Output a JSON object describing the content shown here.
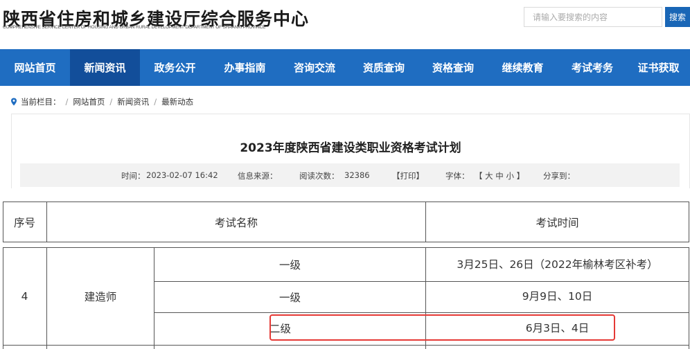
{
  "header": {
    "site_title": "陕西省住房和城乡建设厅综合服务中心",
    "site_subtitle": "COMPREHENSIVE SERVICE CENTER OF HOUSING AND URBAN RURAL DEVELOPMENT DEPARTMENT OF SHAANXI PROVINCE",
    "search_placeholder": "请输入要搜索的内容",
    "search_button": "搜索"
  },
  "nav": {
    "items": [
      {
        "label": "网站首页"
      },
      {
        "label": "新闻资讯",
        "active": true
      },
      {
        "label": "政务公开"
      },
      {
        "label": "办事指南"
      },
      {
        "label": "咨询交流"
      },
      {
        "label": "资质查询"
      },
      {
        "label": "资格查询"
      },
      {
        "label": "继续教育"
      },
      {
        "label": "考试考务"
      },
      {
        "label": "证书获取"
      }
    ]
  },
  "breadcrumb": {
    "prefix": "当前栏目：",
    "items": [
      "网站首页",
      "新闻资讯",
      "最新动态"
    ]
  },
  "article": {
    "title": "2023年度陕西省建设类职业资格考试计划",
    "meta": {
      "time_label": "时间：",
      "time_value": "2023-02-07 16:42",
      "source_label": "信息来源：",
      "views_label": "阅读次数：",
      "views_value": "32386",
      "print_label": "【打印】",
      "font_label": "字体：",
      "font_sizes": "【 大  中  小 】",
      "share_label": "分享到："
    }
  },
  "table": {
    "headers": {
      "no": "序号",
      "name": "考试名称",
      "time": "考试时间"
    },
    "row": {
      "no": "4",
      "name": "建造师",
      "sub_rows": [
        {
          "level": "一级",
          "time": "3月25日、26日（2022年榆林考区补考）"
        },
        {
          "level": "一级",
          "time": "9月9日、10日"
        },
        {
          "level": "二级",
          "time": "6月3日、4日",
          "highlighted": true
        }
      ]
    }
  },
  "colors": {
    "nav_bg": "#1f6dc1",
    "nav_active_bg": "#124e9a",
    "search_button_bg": "#1966b6",
    "highlight_border": "#e53935"
  }
}
